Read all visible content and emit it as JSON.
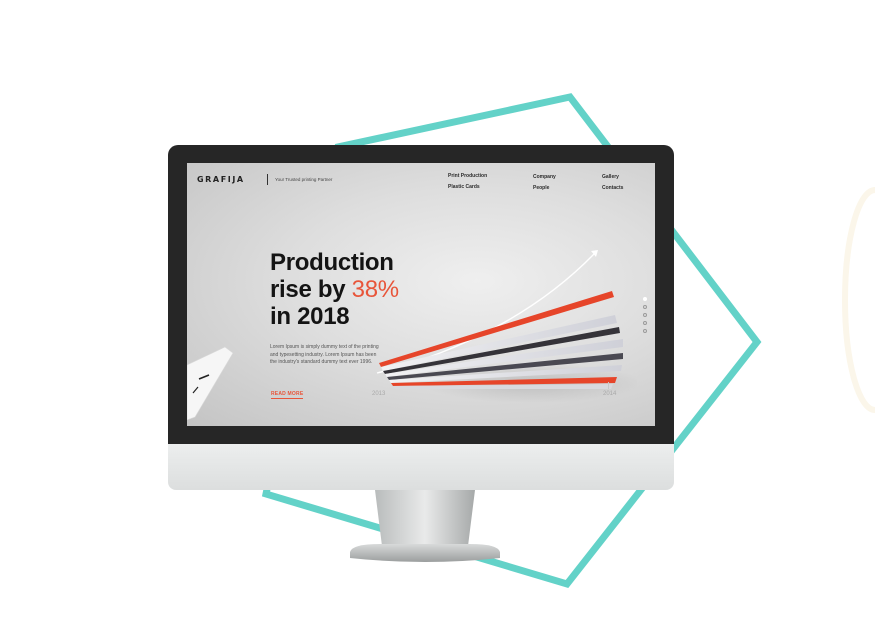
{
  "brand": {
    "logo": "GRAFIJA",
    "tagline": "Your Trusted printing Partner"
  },
  "nav": {
    "print_production": "Print Production",
    "plastic_cards": "Plastic Cards",
    "company": "Company",
    "people": "People",
    "gallery": "Gallery",
    "contacts": "Contacts"
  },
  "hero": {
    "line1": "Production",
    "line2_prefix": "rise by ",
    "line2_accent": "38%",
    "line3": "in 2018",
    "body": "Lorem Ipsum is simply dummy text of the printing and typesetting industry. Lorem Ipsum has been the industry's standard dummy text ever 1996.",
    "cta": "READ MORE",
    "year_start": "2013",
    "year_end": "2014"
  },
  "slider": {
    "total": 5,
    "active_index": 0
  },
  "colors": {
    "accent": "#e8553a",
    "frame_teal": "#63d2c8",
    "bezel": "#262626",
    "headline": "#141414"
  },
  "icons": {
    "chart_arrow": "curved-growth-arrow-icon",
    "slider_dot": "slider-dot-icon"
  }
}
